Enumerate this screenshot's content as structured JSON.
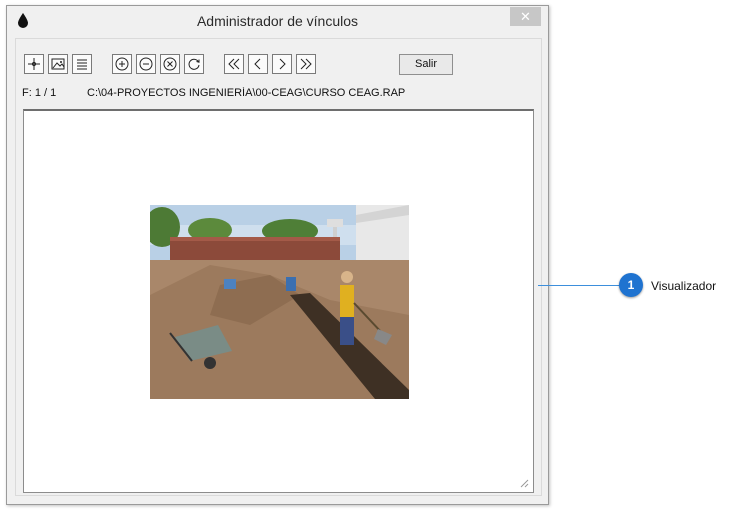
{
  "window": {
    "title": "Administrador de vínculos",
    "close_label": "✕"
  },
  "toolbar": {
    "buttons": [
      {
        "icon": "crosshair-icon"
      },
      {
        "icon": "image-icon"
      },
      {
        "icon": "list-icon"
      },
      {
        "icon": "zoom-in-icon"
      },
      {
        "icon": "zoom-out-icon"
      },
      {
        "icon": "zoom-reset-icon"
      },
      {
        "icon": "rotate-icon"
      },
      {
        "icon": "first-icon"
      },
      {
        "icon": "previous-icon"
      },
      {
        "icon": "next-icon"
      },
      {
        "icon": "last-icon"
      }
    ],
    "exit_label": "Salir"
  },
  "status": {
    "frame": "F: 1 / 1",
    "path": "C:\\04-PROYECTOS INGENIERÍA\\00-CEAG\\CURSO CEAG.RAP"
  },
  "callout": {
    "number": "1",
    "label": "Visualizador"
  },
  "colors": {
    "accent": "#1f73d0",
    "line": "#3d8fdc",
    "window_bg": "#f0f0f0"
  }
}
